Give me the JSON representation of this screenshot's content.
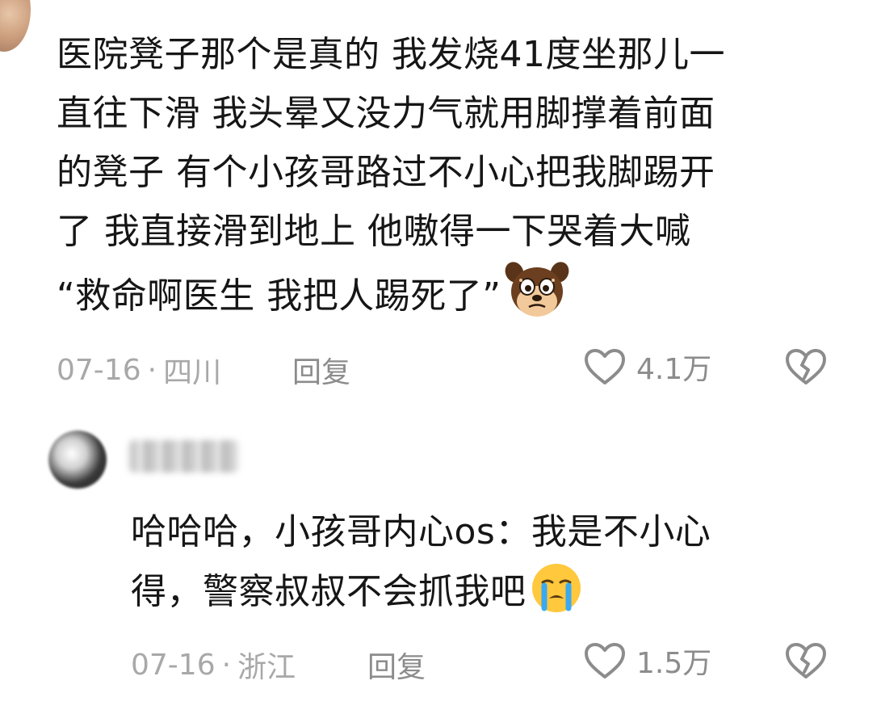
{
  "comments": [
    {
      "lines": [
        "医院凳子那个是真的 我发烧41度坐那儿一",
        "直往下滑 我头晕又没力气就用脚撑着前面",
        "的凳子 有个小孩哥路过不小心把我脚踢开",
        "了 我直接滑到地上 他嗷得一下哭着大喊",
        "“救命啊医生 我把人踢死了”"
      ],
      "emoji": "dog-sticker-icon",
      "date": "07-16",
      "separator": "·",
      "location": "四川",
      "reply_label": "回复",
      "likes": "4.1万"
    },
    {
      "lines": [
        "哈哈哈，小孩哥内心os：我是不小心",
        "得，警察叔叔不会抓我吧"
      ],
      "emoji": "crying-face-icon",
      "date": "07-16",
      "separator": "·",
      "location": "浙江",
      "reply_label": "回复",
      "likes": "1.5万"
    }
  ],
  "colors": {
    "text": "#161616",
    "meta": "#a8a8a8",
    "icon": "#8c8c8c"
  }
}
